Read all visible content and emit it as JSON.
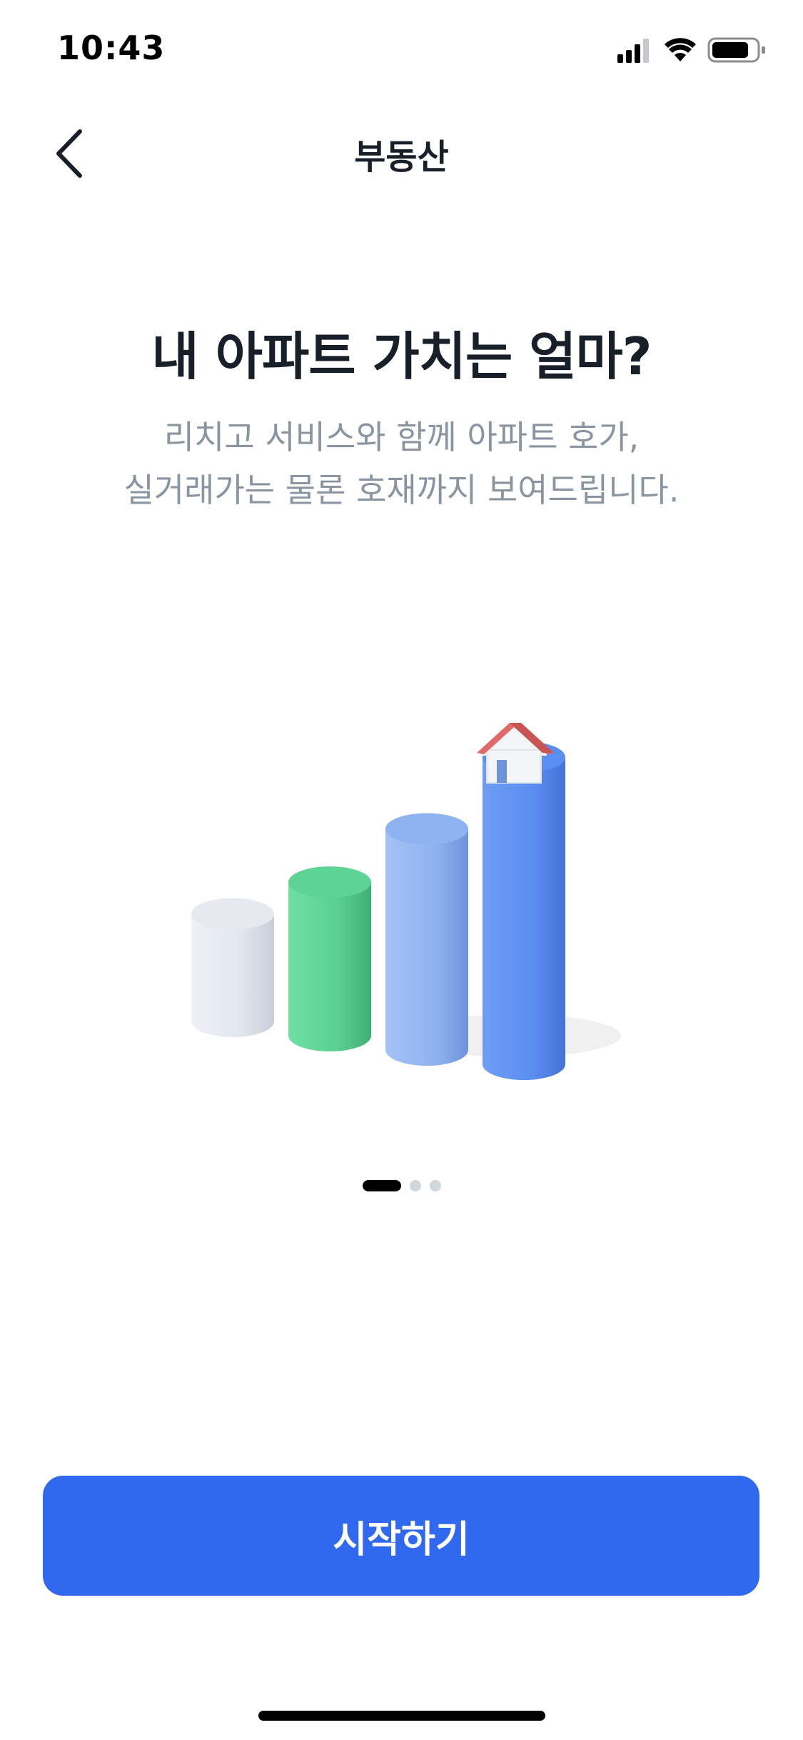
{
  "status_bar": {
    "time": "10:43",
    "icons": [
      "signal-icon",
      "wifi-icon",
      "battery-icon"
    ]
  },
  "nav": {
    "title": "부동산",
    "back_icon": "chevron-left-icon"
  },
  "main": {
    "headline": "내 아파트 가치는 얼마?",
    "subtext_line1": "리치고 서비스와 함께 아파트 호가,",
    "subtext_line2": "실거래가는 물론 호재까지 보여드립니다."
  },
  "illustration": {
    "bars": [
      {
        "color": "#e6e9f0",
        "level": 0.35
      },
      {
        "color": "#5fd394",
        "level": 0.5
      },
      {
        "color": "#8fb2f0",
        "level": 0.72
      },
      {
        "color": "#5a8ef0",
        "level": 1.0
      }
    ],
    "house_icon": "house-icon"
  },
  "pager": {
    "total": 3,
    "current": 1
  },
  "cta": {
    "start_label": "시작하기",
    "color": "#3068f0"
  }
}
